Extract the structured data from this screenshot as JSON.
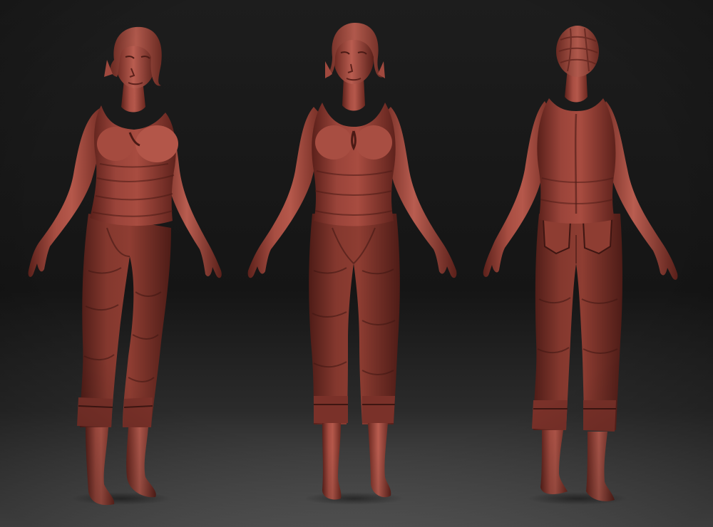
{
  "scene": {
    "views": [
      "three-quarter",
      "front",
      "back"
    ],
    "colors": {
      "background_top": "#1c1c1c",
      "background_mid": "#151515",
      "floor": "#5a5a5a",
      "clay_light": "#b1564a",
      "clay": "#8e3b30",
      "clay_dark": "#5c211b",
      "clay_shadow": "#3e1612"
    }
  }
}
